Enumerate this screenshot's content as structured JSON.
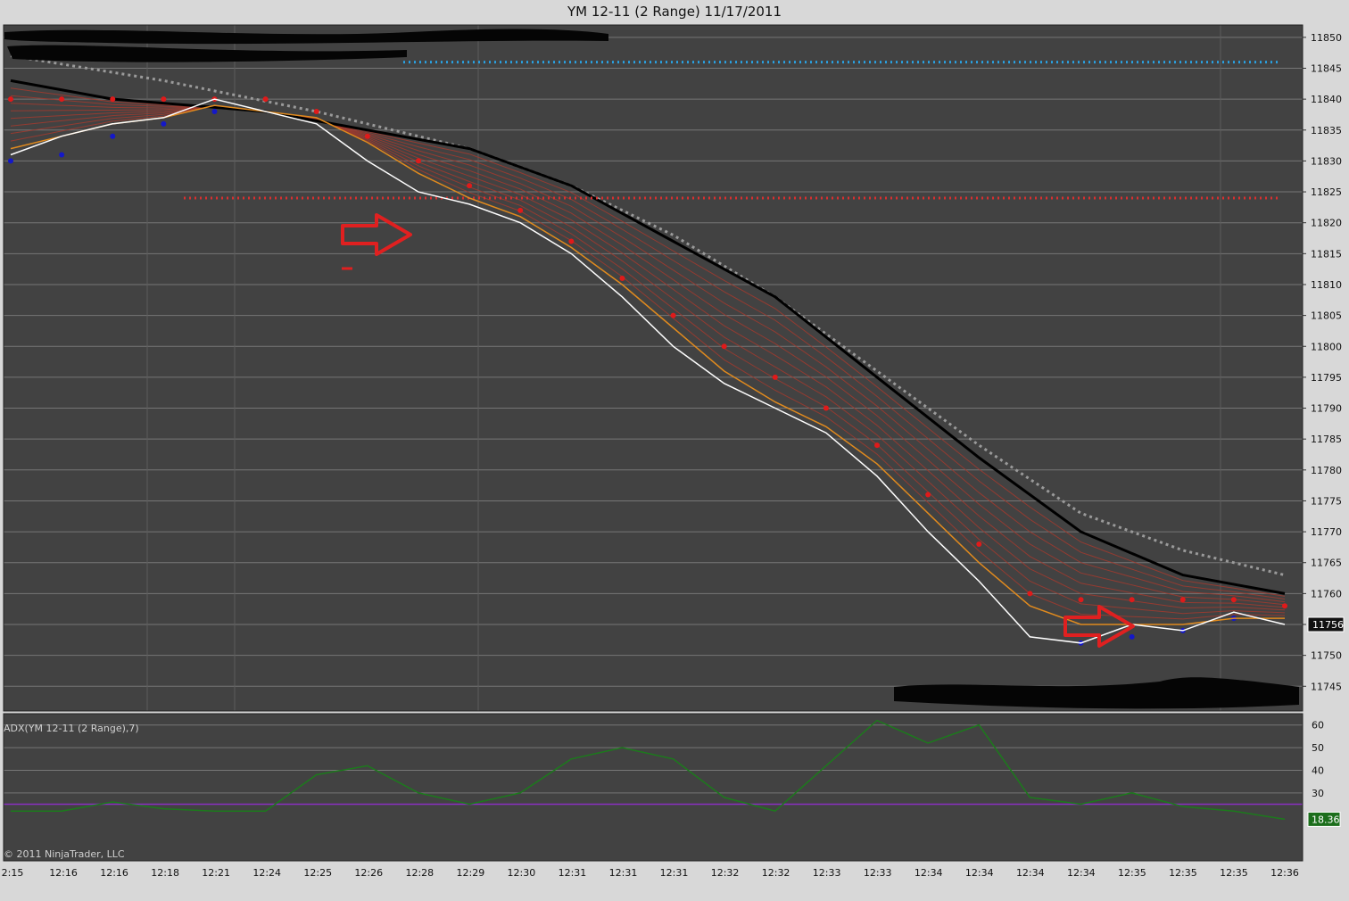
{
  "window": {
    "title": "YM 12-11 (2 Range)  11/17/2011",
    "copyright": "© 2011 NinjaTrader, LLC"
  },
  "colors": {
    "panel_bg": "#424242",
    "grid": "#767676",
    "price_line": "#ffffff",
    "ema_orange": "#e08a1e",
    "ribbon_red": "#a23a2e",
    "slow_ma": "#000000",
    "dotted_ma": "#9a9a9a",
    "dot_red": "#e01a1a",
    "dot_blue": "#1418c8",
    "resistance_dots": "#d83030",
    "target_dots": "#2aa0e0",
    "adx_line": "#1c7a1c",
    "adx_level": "#8a2fc0",
    "annotation_arrow": "#e02020"
  },
  "chart_data": [
    {
      "type": "line",
      "instrument": "YM 12-11 (2 Range)",
      "date": "11/17/2011",
      "ylim": [
        11741,
        11852
      ],
      "y_ticks": [
        11850,
        11845,
        11840,
        11835,
        11830,
        11825,
        11820,
        11815,
        11810,
        11805,
        11800,
        11795,
        11790,
        11785,
        11780,
        11775,
        11770,
        11765,
        11760,
        11755,
        11750,
        11745
      ],
      "x_tick_labels": [
        "2:15",
        "12:16",
        "12:16",
        "12:18",
        "12:21",
        "12:24",
        "12:25",
        "12:26",
        "12:28",
        "12:29",
        "12:30",
        "12:31",
        "12:31",
        "12:31",
        "12:32",
        "12:32",
        "12:33",
        "12:33",
        "12:34",
        "12:34",
        "12:34",
        "12:34",
        "12:35",
        "12:35",
        "12:35",
        "12:36"
      ],
      "grid": true,
      "last_price_label": "11756",
      "series": [
        {
          "values_x": [
            0,
            1,
            2,
            3,
            4,
            5,
            6,
            7,
            8,
            9,
            10,
            11,
            12,
            13,
            14,
            15,
            16,
            17,
            18,
            19,
            20,
            21,
            22,
            23,
            24,
            25
          ],
          "values": [
            11831,
            11834,
            11836,
            11837,
            11840,
            11838,
            11836,
            11830,
            11825,
            11823,
            11820,
            11815,
            11808,
            11800,
            11794,
            11790,
            11786,
            11779,
            11770,
            11762,
            11753,
            11752,
            11755,
            11754,
            11757,
            11755
          ]
        },
        {
          "values_x": [
            0,
            1,
            2,
            3,
            4,
            5,
            6,
            7,
            8,
            9,
            10,
            11,
            12,
            13,
            14,
            15,
            16,
            17,
            18,
            19,
            20,
            21,
            22,
            23,
            24,
            25
          ],
          "values": [
            11832,
            11834,
            11836,
            11837,
            11839,
            11838,
            11837,
            11833,
            11828,
            11824,
            11821,
            11816,
            11810,
            11803,
            11796,
            11791,
            11787,
            11781,
            11773,
            11765,
            11758,
            11755,
            11755,
            11755,
            11756,
            11756
          ]
        },
        {
          "values_x": [
            0,
            2,
            5,
            7,
            9,
            11,
            13,
            15,
            17,
            19,
            21,
            23,
            25
          ],
          "values": [
            11843,
            11840,
            11838,
            11835,
            11832,
            11826,
            11817,
            11808,
            11795,
            11782,
            11770,
            11763,
            11760
          ]
        },
        {
          "values_x": [
            0,
            3,
            6,
            9,
            11,
            13,
            15,
            17,
            19,
            21,
            23,
            25
          ],
          "values": [
            11847,
            11843,
            11838,
            11832,
            11826,
            11818,
            11808,
            11796,
            11784,
            11773,
            11767,
            11763
          ]
        }
      ],
      "markers": {
        "red_dots": [
          {
            "x": 0,
            "y": 11840
          },
          {
            "x": 1,
            "y": 11840
          },
          {
            "x": 2,
            "y": 11840
          },
          {
            "x": 3,
            "y": 11840
          },
          {
            "x": 4,
            "y": 11840
          },
          {
            "x": 5,
            "y": 11840
          },
          {
            "x": 6,
            "y": 11838
          },
          {
            "x": 7,
            "y": 11834
          },
          {
            "x": 8,
            "y": 11830
          },
          {
            "x": 9,
            "y": 11826
          },
          {
            "x": 10,
            "y": 11822
          },
          {
            "x": 11,
            "y": 11817
          },
          {
            "x": 12,
            "y": 11811
          },
          {
            "x": 13,
            "y": 11805
          },
          {
            "x": 14,
            "y": 11800
          },
          {
            "x": 15,
            "y": 11795
          },
          {
            "x": 16,
            "y": 11790
          },
          {
            "x": 17,
            "y": 11784
          },
          {
            "x": 18,
            "y": 11776
          },
          {
            "x": 19,
            "y": 11768
          },
          {
            "x": 20,
            "y": 11760
          },
          {
            "x": 21,
            "y": 11759
          },
          {
            "x": 22,
            "y": 11759
          },
          {
            "x": 23,
            "y": 11759
          },
          {
            "x": 24,
            "y": 11759
          },
          {
            "x": 25,
            "y": 11758
          }
        ],
        "blue_dots": [
          {
            "x": 0,
            "y": 11830
          },
          {
            "x": 1,
            "y": 11831
          },
          {
            "x": 2,
            "y": 11834
          },
          {
            "x": 3,
            "y": 11836
          },
          {
            "x": 4,
            "y": 11838
          },
          {
            "x": 21,
            "y": 11752
          },
          {
            "x": 22,
            "y": 11753
          },
          {
            "x": 23,
            "y": 11754
          },
          {
            "x": 24,
            "y": 11756
          }
        ],
        "resistance_level": 11824,
        "target_level": 11846
      }
    },
    {
      "type": "line",
      "title": "ADX(YM 12-11 (2 Range),7)",
      "ylim": [
        0,
        65
      ],
      "y_ticks": [
        60,
        50,
        40,
        30
      ],
      "reference_level": 25,
      "last_value_label": "18.36",
      "series": [
        {
          "values_x": [
            0,
            1,
            2,
            3,
            4,
            5,
            6,
            7,
            8,
            9,
            10,
            11,
            12,
            13,
            14,
            15,
            16,
            17,
            18,
            19,
            20,
            21,
            22,
            23,
            24,
            25
          ],
          "values": [
            22,
            22,
            26,
            23,
            22,
            22,
            38,
            42,
            30,
            25,
            30,
            45,
            50,
            45,
            28,
            22,
            42,
            62,
            52,
            60,
            28,
            25,
            30,
            24,
            22,
            18.36
          ]
        }
      ]
    }
  ]
}
